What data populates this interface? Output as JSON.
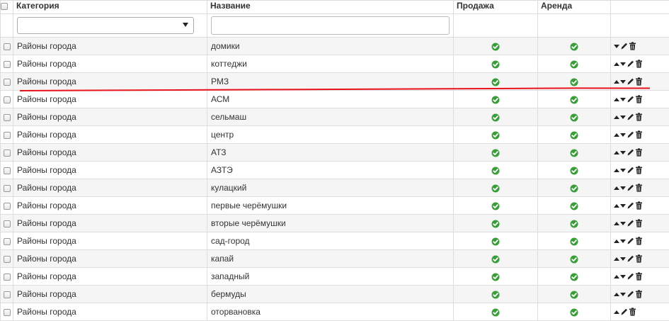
{
  "headers": {
    "category": "Категория",
    "name": "Название",
    "sale": "Продажа",
    "rent": "Аренда"
  },
  "filters": {
    "category_selected": "",
    "name_value": ""
  },
  "colors": {
    "check_green": "#3a9d3a",
    "annotation_red": "#e8141b",
    "row_alt": "#f5f5f5"
  },
  "rows": [
    {
      "category": "Районы города",
      "name": "домики",
      "sale": true,
      "rent": true,
      "up": false,
      "down": true
    },
    {
      "category": "Районы города",
      "name": "коттеджи",
      "sale": true,
      "rent": true,
      "up": true,
      "down": true
    },
    {
      "category": "Районы города",
      "name": "РМЗ",
      "sale": true,
      "rent": true,
      "up": true,
      "down": true
    },
    {
      "category": "Районы города",
      "name": "АСМ",
      "sale": true,
      "rent": true,
      "up": true,
      "down": true
    },
    {
      "category": "Районы города",
      "name": "сельмаш",
      "sale": true,
      "rent": true,
      "up": true,
      "down": true
    },
    {
      "category": "Районы города",
      "name": "центр",
      "sale": true,
      "rent": true,
      "up": true,
      "down": true
    },
    {
      "category": "Районы города",
      "name": "АТЗ",
      "sale": true,
      "rent": true,
      "up": true,
      "down": true
    },
    {
      "category": "Районы города",
      "name": "АЗТЭ",
      "sale": true,
      "rent": true,
      "up": true,
      "down": true
    },
    {
      "category": "Районы города",
      "name": "кулацкий",
      "sale": true,
      "rent": true,
      "up": true,
      "down": true
    },
    {
      "category": "Районы города",
      "name": "первые черёмушки",
      "sale": true,
      "rent": true,
      "up": true,
      "down": true
    },
    {
      "category": "Районы города",
      "name": "вторые черёмушки",
      "sale": true,
      "rent": true,
      "up": true,
      "down": true
    },
    {
      "category": "Районы города",
      "name": "сад-город",
      "sale": true,
      "rent": true,
      "up": true,
      "down": true
    },
    {
      "category": "Районы города",
      "name": "капай",
      "sale": true,
      "rent": true,
      "up": true,
      "down": true
    },
    {
      "category": "Районы города",
      "name": "западный",
      "sale": true,
      "rent": true,
      "up": true,
      "down": true
    },
    {
      "category": "Районы города",
      "name": "бермуды",
      "sale": true,
      "rent": true,
      "up": true,
      "down": true
    },
    {
      "category": "Районы города",
      "name": "оторвановка",
      "sale": true,
      "rent": true,
      "up": true,
      "down": false
    }
  ]
}
